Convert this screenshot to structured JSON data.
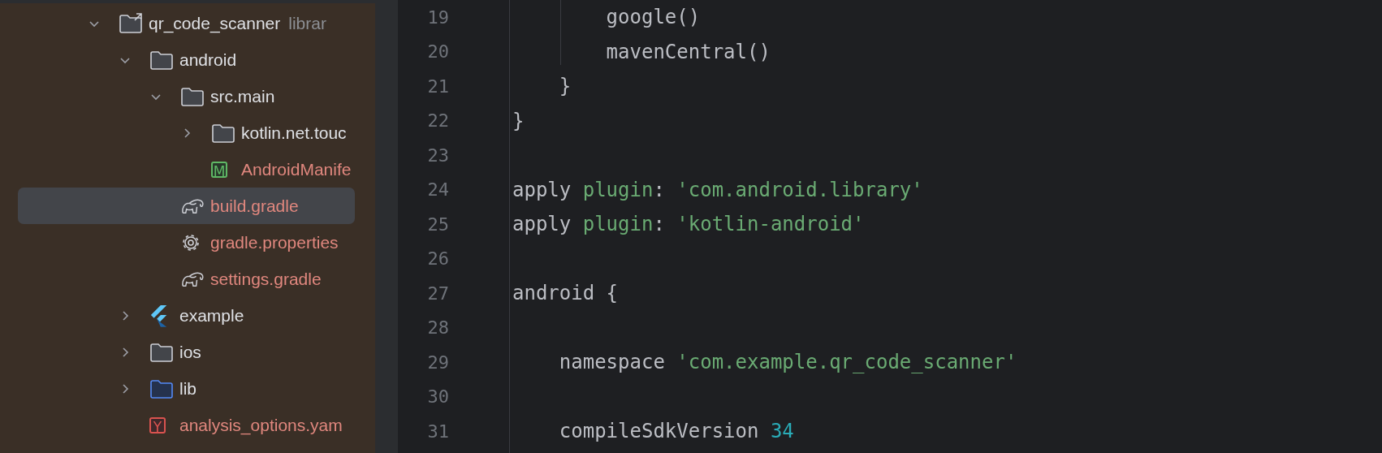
{
  "project_tree": [
    {
      "name": "qr_code_scanner",
      "suffix": "librar",
      "kind": "module",
      "expanded": true,
      "selected": false,
      "unversioned": false,
      "children": [
        {
          "name": "android",
          "kind": "folder",
          "expanded": true,
          "selected": false,
          "unversioned": false,
          "children": [
            {
              "name": "src.main",
              "kind": "folder",
              "expanded": true,
              "selected": false,
              "unversioned": false,
              "children": [
                {
                  "name": "kotlin.net.touc",
                  "kind": "folder",
                  "expanded": false,
                  "selected": false,
                  "unversioned": false
                },
                {
                  "name": "AndroidManife",
                  "kind": "manifest",
                  "icon_letter": "M",
                  "selected": false,
                  "unversioned": true
                }
              ]
            },
            {
              "name": "build.gradle",
              "kind": "gradle",
              "selected": true,
              "unversioned": true
            },
            {
              "name": "gradle.properties",
              "kind": "settings",
              "selected": false,
              "unversioned": true
            },
            {
              "name": "settings.gradle",
              "kind": "gradle",
              "selected": false,
              "unversioned": true
            }
          ]
        },
        {
          "name": "example",
          "kind": "flutter",
          "expanded": false,
          "selected": false,
          "unversioned": false
        },
        {
          "name": "ios",
          "kind": "folder",
          "expanded": false,
          "selected": false,
          "unversioned": false
        },
        {
          "name": "lib",
          "kind": "source",
          "expanded": false,
          "selected": false,
          "unversioned": false
        },
        {
          "name": "analysis_options.yam",
          "kind": "yaml",
          "icon_letter": "Y",
          "selected": false,
          "unversioned": true
        }
      ]
    }
  ],
  "editor": {
    "lines": [
      {
        "number": "19",
        "tokens": [
          {
            "text": "        google()",
            "kind": "plain"
          }
        ]
      },
      {
        "number": "20",
        "tokens": [
          {
            "text": "        mavenCentral()",
            "kind": "plain"
          }
        ]
      },
      {
        "number": "21",
        "tokens": [
          {
            "text": "    }",
            "kind": "plain"
          }
        ]
      },
      {
        "number": "22",
        "tokens": [
          {
            "text": "}",
            "kind": "plain"
          }
        ]
      },
      {
        "number": "23"
      },
      {
        "number": "24",
        "tokens": [
          {
            "text": "apply ",
            "kind": "plain"
          },
          {
            "text": "plugin",
            "kind": "named"
          },
          {
            "text": ": ",
            "kind": "plain"
          },
          {
            "text": "'com.android.library'",
            "kind": "string"
          }
        ]
      },
      {
        "number": "25",
        "tokens": [
          {
            "text": "apply ",
            "kind": "plain"
          },
          {
            "text": "plugin",
            "kind": "named"
          },
          {
            "text": ": ",
            "kind": "plain"
          },
          {
            "text": "'kotlin-android'",
            "kind": "string"
          }
        ]
      },
      {
        "number": "26"
      },
      {
        "number": "27",
        "tokens": [
          {
            "text": "android {",
            "kind": "plain"
          }
        ]
      },
      {
        "number": "28"
      },
      {
        "number": "29",
        "tokens": [
          {
            "text": "    namespace ",
            "kind": "plain"
          },
          {
            "text": "'com.example.qr_code_scanner'",
            "kind": "string"
          }
        ]
      },
      {
        "number": "30"
      },
      {
        "number": "31",
        "tokens": [
          {
            "text": "    compileSdkVersion ",
            "kind": "plain"
          },
          {
            "text": "34",
            "kind": "number"
          }
        ]
      }
    ]
  }
}
